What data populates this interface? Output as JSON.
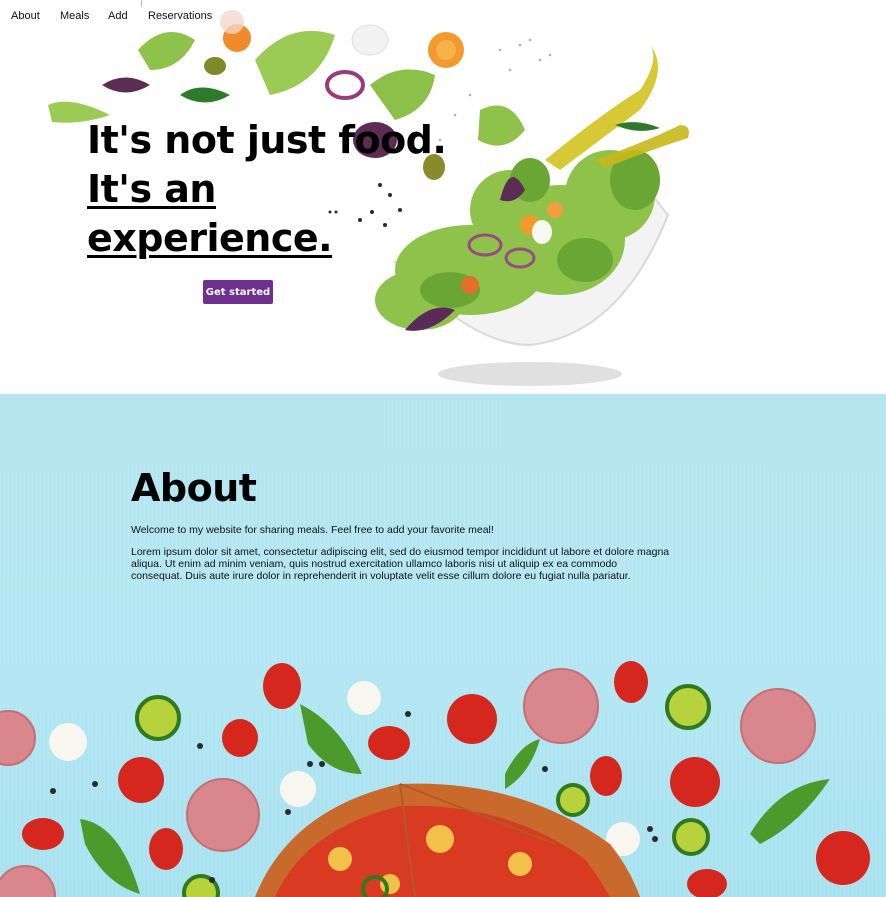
{
  "nav": {
    "items": [
      {
        "label": "About"
      },
      {
        "label": "Meals"
      },
      {
        "label": "Add"
      },
      {
        "label": "Reservations"
      }
    ]
  },
  "hero": {
    "title_line1": "It's not just food.",
    "title_line2": "It's an",
    "title_line3": "experience.",
    "cta_label": "Get started",
    "image": "salad-bowl-photo"
  },
  "about": {
    "title": "About",
    "welcome": "Welcome to my website for sharing meals. Feel free to add your favorite meal!",
    "lorem": "Lorem ipsum dolor sit amet, consectetur adipiscing elit, sed do eiusmod tempor incididunt ut labore et dolore magna aliqua. Ut enim ad minim veniam, quis nostrud exercitation ullamco laboris nisi ut aliquip ex ea commodo consequat. Duis aute irure dolor in reprehenderit in voluptate velit esse cillum dolore eu fugiat nulla pariatur.",
    "image": "pizza-ingredients-photo"
  },
  "colors": {
    "cta": "#6f2f8e",
    "about_bg": "#b4e6f1"
  }
}
